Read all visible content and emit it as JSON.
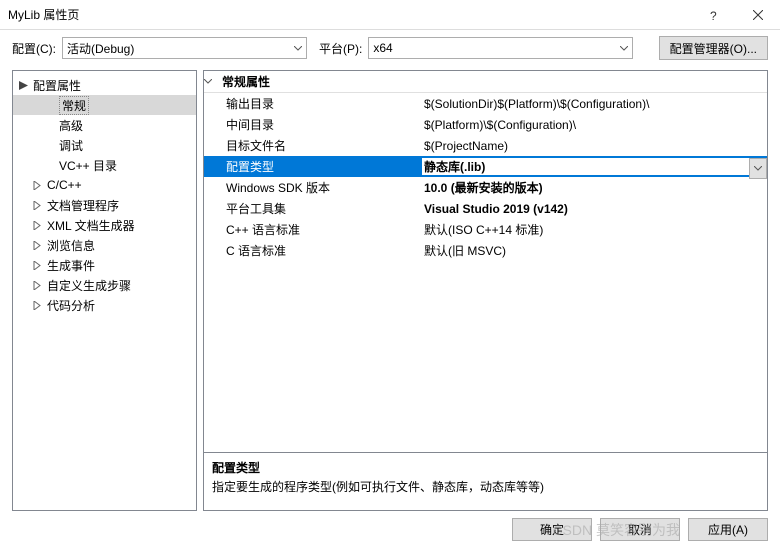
{
  "title": "MyLib 属性页",
  "toolbar": {
    "config_label": "配置(C):",
    "config_value": "活动(Debug)",
    "platform_label": "平台(P):",
    "platform_value": "x64",
    "manager_button": "配置管理器(O)..."
  },
  "tree": {
    "root": "配置属性",
    "items": [
      {
        "label": "常规",
        "leaf": true,
        "selected": true
      },
      {
        "label": "高级",
        "leaf": true
      },
      {
        "label": "调试",
        "leaf": true
      },
      {
        "label": "VC++ 目录",
        "leaf": true
      },
      {
        "label": "C/C++",
        "leaf": false
      },
      {
        "label": "文档管理程序",
        "leaf": false
      },
      {
        "label": "XML 文档生成器",
        "leaf": false
      },
      {
        "label": "浏览信息",
        "leaf": false
      },
      {
        "label": "生成事件",
        "leaf": false
      },
      {
        "label": "自定义生成步骤",
        "leaf": false
      },
      {
        "label": "代码分析",
        "leaf": false
      }
    ]
  },
  "grid": {
    "header": "常规属性",
    "rows": [
      {
        "prop": "输出目录",
        "val": "$(SolutionDir)$(Platform)\\$(Configuration)\\"
      },
      {
        "prop": "中间目录",
        "val": "$(Platform)\\$(Configuration)\\"
      },
      {
        "prop": "目标文件名",
        "val": "$(ProjectName)"
      },
      {
        "prop": "配置类型",
        "val": "静态库(.lib)",
        "selected": true,
        "bold": true
      },
      {
        "prop": "Windows SDK 版本",
        "val": "10.0 (最新安装的版本)",
        "bold": true
      },
      {
        "prop": "平台工具集",
        "val": "Visual Studio 2019 (v142)",
        "bold": true
      },
      {
        "prop": "C++ 语言标准",
        "val": "默认(ISO C++14 标准)"
      },
      {
        "prop": "C 语言标准",
        "val": "默认(旧 MSVC)"
      }
    ]
  },
  "description": {
    "title": "配置类型",
    "text": "指定要生成的程序类型(例如可执行文件、静态库，动态库等等)"
  },
  "footer": {
    "ok": "确定",
    "cancel": "取消",
    "apply": "应用(A)"
  },
  "watermark": "CSDN 莫笑容别为我"
}
